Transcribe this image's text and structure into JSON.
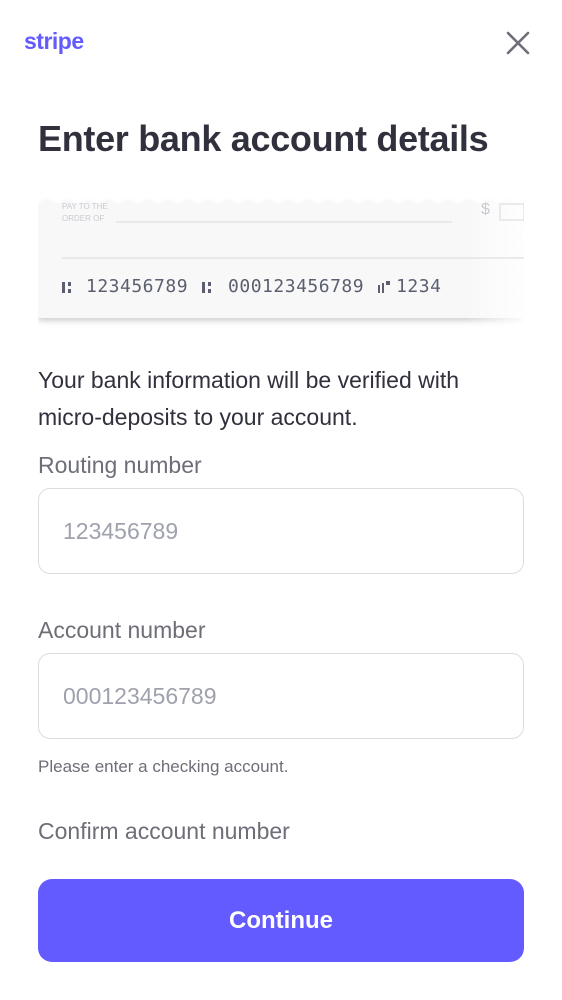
{
  "header": {
    "logo_text": "stripe",
    "close_icon": "close-icon"
  },
  "title": "Enter bank account details",
  "check_illustration": {
    "pay_to_line1": "PAY TO THE",
    "pay_to_line2": "ORDER OF",
    "currency_symbol": "$",
    "routing_number": "123456789",
    "account_number": "000123456789",
    "check_number": "1234"
  },
  "description": "Your bank information will be verified with micro-deposits to your account.",
  "fields": {
    "routing": {
      "label": "Routing number",
      "placeholder": "123456789",
      "value": ""
    },
    "account": {
      "label": "Account number",
      "placeholder": "000123456789",
      "value": "",
      "hint": "Please enter a checking account."
    },
    "confirm": {
      "label": "Confirm account number"
    }
  },
  "actions": {
    "continue_label": "Continue"
  },
  "colors": {
    "brand": "#635bff",
    "text": "#30313d",
    "muted": "#6d6e78",
    "border": "#dcdde2"
  }
}
